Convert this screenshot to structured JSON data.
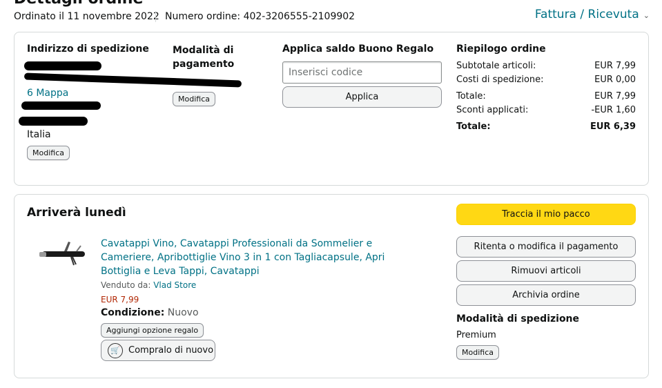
{
  "header": {
    "ordered_on": "Ordinato il 11 novembre 2022",
    "order_number": "Numero ordine: 402-3206555-2109902",
    "invoice_link": "Fattura / Ricevuta"
  },
  "shipping_address": {
    "title": "Indirizzo di spedizione",
    "map_link": "6 Mappa",
    "country": "Italia",
    "edit_label": "Modifica"
  },
  "payment": {
    "title": "Modalità di pagamento",
    "edit_label": "Modifica"
  },
  "gift_card": {
    "title": "Applica saldo Buono Regalo",
    "placeholder": "Inserisci codice",
    "apply_label": "Applica"
  },
  "summary": {
    "title": "Riepilogo ordine",
    "rows": [
      {
        "label": "Subtotale articoli:",
        "value": "EUR 7,99"
      },
      {
        "label": "Costi di spedizione:",
        "value": "EUR 0,00"
      },
      {
        "label": "Totale:",
        "value": "EUR 7,99"
      },
      {
        "label": "Sconti applicati:",
        "value": "-EUR 1,60"
      }
    ],
    "grand_total_label": "Totale:",
    "grand_total_value": "EUR 6,39"
  },
  "shipment": {
    "arrival": "Arriverà lunedì",
    "product_title": "Cavatappi Vino, Cavatappi Professionali da Sommelier e Cameriere, Apribottiglie Vino 3 in 1 con Tagliacapsule, Apri Bottiglia e Leva Tappi, Cavatappi",
    "sold_by_label": "Venduto da:",
    "seller": "Vlad Store",
    "price": "EUR 7,99",
    "condition_label": "Condizione:",
    "condition_value": "Nuovo",
    "gift_option_label": "Aggiungi opzione regalo",
    "buy_again_label": "Compralo di nuovo"
  },
  "actions": {
    "track": "Traccia il mio pacco",
    "retry_payment": "Ritenta o modifica il pagamento",
    "remove_items": "Rimuovi articoli",
    "archive": "Archivia ordine"
  },
  "shipping_method": {
    "title": "Modalità di spedizione",
    "value": "Premium",
    "edit_label": "Modifica"
  },
  "colors": {
    "link": "#007185",
    "price": "#b12704",
    "track_button": "#ffd814"
  }
}
